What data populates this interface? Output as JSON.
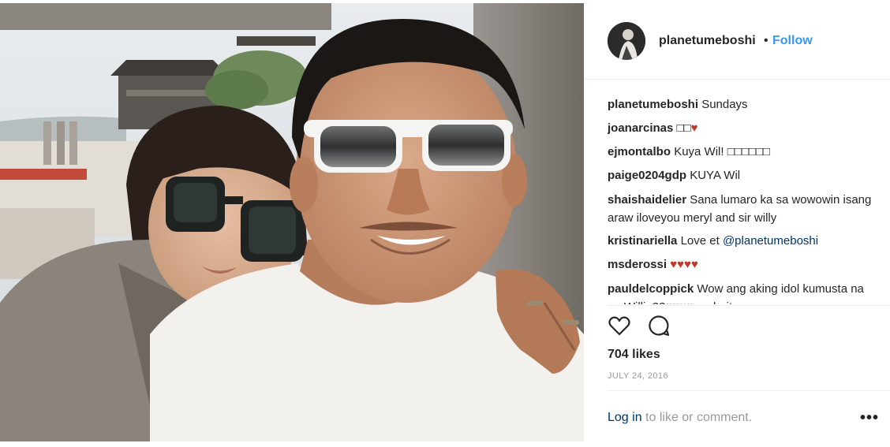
{
  "header": {
    "username": "planetumeboshi",
    "separator": "•",
    "follow_label": "Follow"
  },
  "comments": [
    {
      "user": "planetumeboshi",
      "text": "Sundays"
    },
    {
      "user": "joanarcinas",
      "text": "□□",
      "heart": "♥"
    },
    {
      "user": "ejmontalbo",
      "text": "Kuya Wil! □□□□□□"
    },
    {
      "user": "paige0204gdp",
      "text": "KUYA Wil"
    },
    {
      "user": "shaishaidelier",
      "text": "Sana lumaro ka sa wowowin isang araw iloveyou meryl and sir willy"
    },
    {
      "user": "kristinariella",
      "text": "Love et",
      "mention": "@planetumeboshi"
    },
    {
      "user": "msderossi",
      "text": "",
      "heart": "♥♥♥♥"
    },
    {
      "user": "pauldelcoppick",
      "text": "Wow ang aking idol kumusta na po Willie??♥♥♥♥ mabait"
    }
  ],
  "actions": {
    "like_icon": "heart-outline-icon",
    "comment_icon": "speech-bubble-icon"
  },
  "likes_text": "704 likes",
  "date_text": "JULY 24, 2016",
  "footer": {
    "login_label": "Log in",
    "login_suffix": " to like or comment.",
    "more_label": "•••"
  },
  "colors": {
    "link_blue": "#3897f0",
    "text_dark": "#262626",
    "muted": "#999999",
    "heart_red": "#c0392b"
  }
}
